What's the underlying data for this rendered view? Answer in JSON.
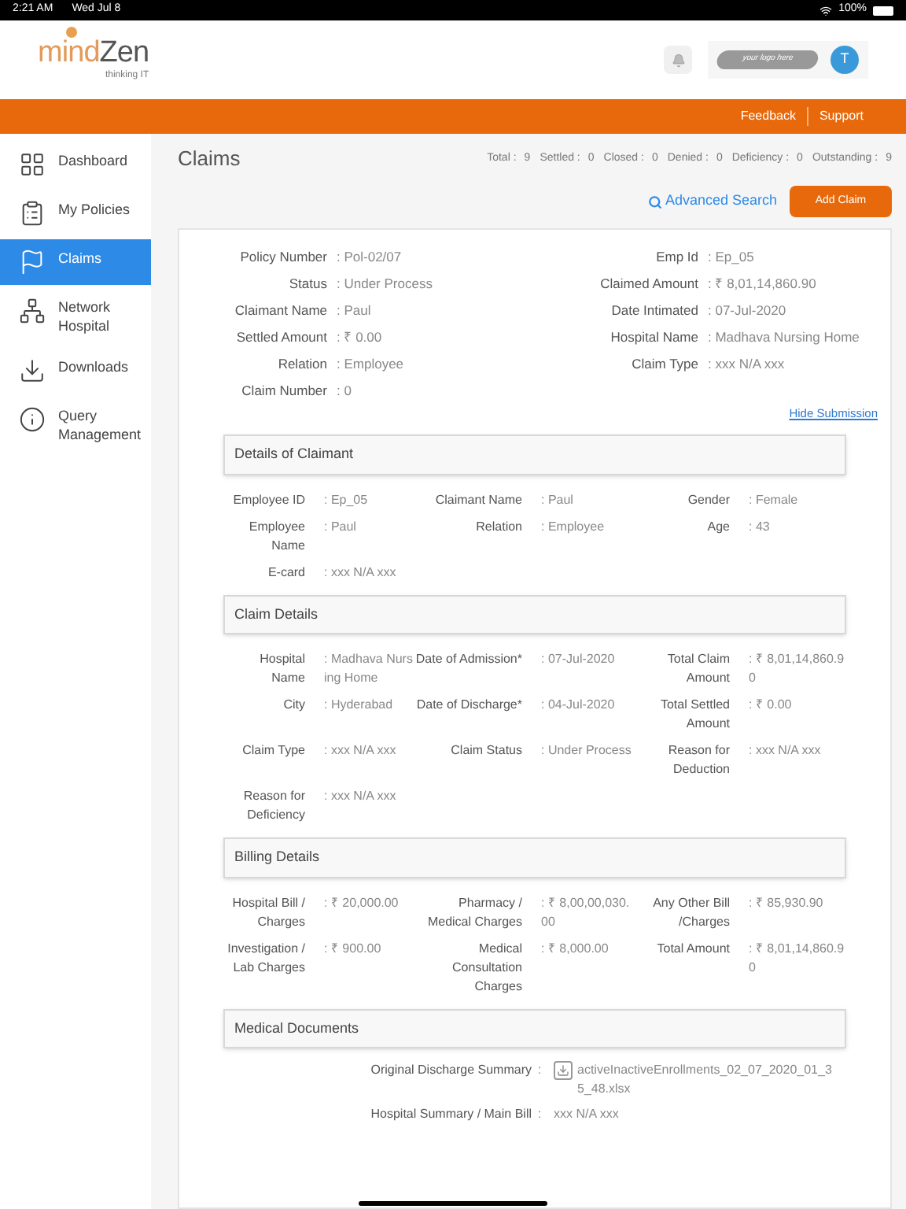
{
  "status_bar": {
    "time": "2:21 AM",
    "date": "Wed Jul 8",
    "battery": "100%"
  },
  "header": {
    "logo_main": "mind",
    "logo_accent": "Zen",
    "logo_tagline": "thinking IT",
    "client_logo": "your logo here",
    "avatar": "T"
  },
  "top_links": [
    "Feedback",
    "Support"
  ],
  "sidebar": {
    "items": [
      {
        "label": "Dashboard",
        "selected": false
      },
      {
        "label": "My Policies",
        "selected": false
      },
      {
        "label": "Claims",
        "selected": true
      },
      {
        "label": "Network Hospital",
        "selected": false
      },
      {
        "label": "Downloads",
        "selected": false
      },
      {
        "label": "Query Management",
        "selected": false
      }
    ]
  },
  "page_title": "Claims",
  "stats": [
    {
      "label": "Total :",
      "value": "9"
    },
    {
      "label": "Settled :",
      "value": "0"
    },
    {
      "label": "Closed :",
      "value": "0"
    },
    {
      "label": "Denied :",
      "value": "0"
    },
    {
      "label": "Deficiency :",
      "value": "0"
    },
    {
      "label": "Outstanding :",
      "value": "9"
    }
  ],
  "advanced_search": "Advanced Search",
  "add_claim": "Add Claim",
  "summary": {
    "left": [
      {
        "label": "Policy Number",
        "value": ": Pol-02/07"
      },
      {
        "label": "Status",
        "value": ": Under Process"
      },
      {
        "label": "Claimant Name",
        "value": ": Paul"
      },
      {
        "label": "Settled Amount",
        "value": ": ₹ 0.00"
      },
      {
        "label": "Relation",
        "value": ": Employee"
      },
      {
        "label": "Claim Number",
        "value": ": 0"
      }
    ],
    "right": [
      {
        "label": "Emp Id",
        "value": ": Ep_05"
      },
      {
        "label": "Claimed Amount",
        "value": ": ₹ 8,01,14,860.90"
      },
      {
        "label": "Date Intimated",
        "value": ": 07-Jul-2020"
      },
      {
        "label": "Hospital Name",
        "value": ": Madhava Nursing Home"
      },
      {
        "label": "Claim Type",
        "value": ": xxx N/A xxx"
      }
    ]
  },
  "hide_submission": "Hide Submission",
  "sections": [
    {
      "title": "Details of Claimant",
      "fields": [
        {
          "label": "Employee ID",
          "value": ": Ep_05"
        },
        {
          "label": "Claimant Name",
          "value": ": Paul"
        },
        {
          "label": "Gender",
          "value": ": Female"
        },
        {
          "label": "Employee Name",
          "value": ": Paul"
        },
        {
          "label": "Relation",
          "value": ": Employee"
        },
        {
          "label": "Age",
          "value": ": 43"
        },
        {
          "label": "E-card",
          "value": ": xxx N/A xxx"
        }
      ]
    },
    {
      "title": "Claim Details",
      "fields": [
        {
          "label": "Hospital Name",
          "value": ": Madhava Nursing Home"
        },
        {
          "label": "Date of Admission*",
          "value": ": 07-Jul-2020"
        },
        {
          "label": "Total Claim Amount",
          "value": ": ₹ 8,01,14,860.90"
        },
        {
          "label": "City",
          "value": ": Hyderabad"
        },
        {
          "label": "Date of Discharge*",
          "value": ": 04-Jul-2020"
        },
        {
          "label": "Total Settled Amount",
          "value": ": ₹ 0.00"
        },
        {
          "label": "Claim Type",
          "value": ": xxx N/A xxx"
        },
        {
          "label": "Claim Status",
          "value": ": Under Process"
        },
        {
          "label": "Reason for Deduction",
          "value": ": xxx N/A xxx"
        },
        {
          "label": "Reason for Deficiency",
          "value": ": xxx N/A xxx"
        }
      ]
    },
    {
      "title": "Billing Details",
      "fields": [
        {
          "label": "Hospital Bill / Charges",
          "value": ": ₹ 20,000.00"
        },
        {
          "label": "Pharmacy / Medical Charges",
          "value": ": ₹ 8,00,00,030.00"
        },
        {
          "label": "Any Other Bill /Charges",
          "value": ": ₹ 85,930.90"
        },
        {
          "label": "Investigation / Lab Charges",
          "value": ": ₹ 900.00"
        },
        {
          "label": "Medical Consultation Charges",
          "value": ": ₹ 8,000.00"
        },
        {
          "label": "Total Amount",
          "value": ": ₹ 8,01,14,860.90"
        }
      ]
    }
  ],
  "documents": {
    "title": "Medical Documents",
    "rows": [
      {
        "label": "Original Discharge Summary",
        "separator": ":",
        "value": "activeInactiveEnrollments_02_07_2020_01_35_48.xlsx",
        "kind": "file"
      },
      {
        "label": "Hospital Summary / Main Bill",
        "separator": ":",
        "value": "xxx N/A xxx",
        "kind": "text"
      }
    ]
  }
}
